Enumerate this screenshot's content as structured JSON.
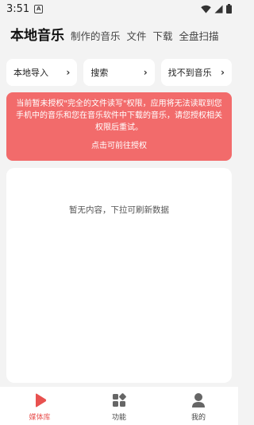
{
  "status_bar": {
    "time": "3:51",
    "notification_badge": "A"
  },
  "header": {
    "tabs": [
      {
        "label": "本地音乐",
        "active": true
      },
      {
        "label": "制作的音乐",
        "active": false
      },
      {
        "label": "文件",
        "active": false
      },
      {
        "label": "下载",
        "active": false
      },
      {
        "label": "全盘扫描",
        "active": false
      }
    ]
  },
  "actions": [
    {
      "label": "本地导入"
    },
    {
      "label": "搜索"
    },
    {
      "label": "找不到音乐"
    }
  ],
  "permission_alert": {
    "message": "当前暂未授权\"完全的文件读写\"权限，应用将无法读取到您手机中的音乐和您在音乐软件中下载的音乐，请您授权相关权限后重试。",
    "link_label": "点击可前往授权",
    "background_color": "#f26b6b"
  },
  "content": {
    "empty_text": "暂无内容，下拉可刷新数据"
  },
  "bottom_nav": {
    "items": [
      {
        "label": "媒体库",
        "icon": "play-icon",
        "active": true
      },
      {
        "label": "功能",
        "icon": "grid-icon",
        "active": false
      },
      {
        "label": "我的",
        "icon": "person-icon",
        "active": false
      }
    ],
    "accent_color": "#e8514f"
  }
}
